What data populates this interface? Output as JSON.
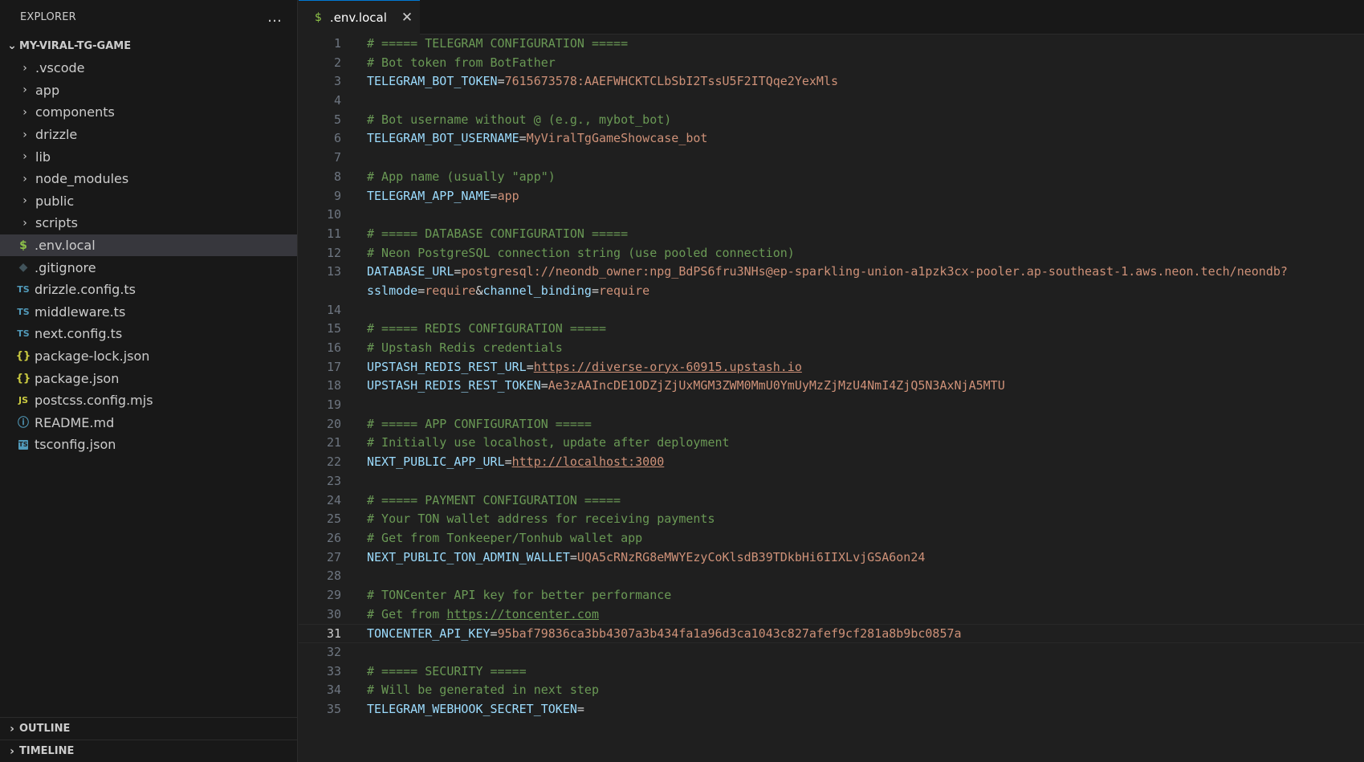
{
  "sidebar": {
    "title": "EXPLORER",
    "more_icon": "…",
    "project": "MY-VIRAL-TG-GAME",
    "folders": [
      ".vscode",
      "app",
      "components",
      "drizzle",
      "lib",
      "node_modules",
      "public",
      "scripts"
    ],
    "files": [
      {
        "name": ".env.local",
        "icon": "dollar-icon",
        "glyph": "$"
      },
      {
        "name": ".gitignore",
        "icon": "git-icon",
        "glyph": "◆"
      },
      {
        "name": "drizzle.config.ts",
        "icon": "ts-icon",
        "glyph": "TS"
      },
      {
        "name": "middleware.ts",
        "icon": "ts-icon",
        "glyph": "TS"
      },
      {
        "name": "next.config.ts",
        "icon": "ts-icon",
        "glyph": "TS"
      },
      {
        "name": "package-lock.json",
        "icon": "json-icon",
        "glyph": "{}"
      },
      {
        "name": "package.json",
        "icon": "json-icon",
        "glyph": "{}"
      },
      {
        "name": "postcss.config.mjs",
        "icon": "js-icon",
        "glyph": "JS"
      },
      {
        "name": "README.md",
        "icon": "info-icon",
        "glyph": "ⓘ"
      },
      {
        "name": "tsconfig.json",
        "icon": "tsconfig-icon",
        "glyph": "TS"
      }
    ],
    "sections": [
      "OUTLINE",
      "TIMELINE"
    ]
  },
  "editor": {
    "tab": {
      "label": ".env.local",
      "icon": "$",
      "close": "✕"
    },
    "active_line": 31,
    "lines": [
      {
        "n": "1",
        "parts": [
          [
            "c",
            "# ===== TELEGRAM CONFIGURATION ====="
          ]
        ]
      },
      {
        "n": "2",
        "parts": [
          [
            "c",
            "# Bot token from BotFather"
          ]
        ]
      },
      {
        "n": "3",
        "parts": [
          [
            "k",
            "TELEGRAM_BOT_TOKEN"
          ],
          [
            "e",
            "="
          ],
          [
            "v",
            "7615673578:AAEFWHCKTCLbSbI2TssU5F2ITQqe2YexMls"
          ]
        ]
      },
      {
        "n": "4",
        "parts": []
      },
      {
        "n": "5",
        "parts": [
          [
            "c",
            "# Bot username without @ (e.g., mybot_bot)"
          ]
        ]
      },
      {
        "n": "6",
        "parts": [
          [
            "k",
            "TELEGRAM_BOT_USERNAME"
          ],
          [
            "e",
            "="
          ],
          [
            "v",
            "MyViralTgGameShowcase_bot"
          ]
        ]
      },
      {
        "n": "7",
        "parts": []
      },
      {
        "n": "8",
        "parts": [
          [
            "c",
            "# App name (usually \"app\")"
          ]
        ]
      },
      {
        "n": "9",
        "parts": [
          [
            "k",
            "TELEGRAM_APP_NAME"
          ],
          [
            "e",
            "="
          ],
          [
            "v",
            "app"
          ]
        ]
      },
      {
        "n": "10",
        "parts": []
      },
      {
        "n": "11",
        "parts": [
          [
            "c",
            "# ===== DATABASE CONFIGURATION ====="
          ]
        ]
      },
      {
        "n": "12",
        "parts": [
          [
            "c",
            "# Neon PostgreSQL connection string (use pooled connection)"
          ]
        ]
      },
      {
        "n": "13",
        "parts": [
          [
            "k",
            "DATABASE_URL"
          ],
          [
            "e",
            "="
          ],
          [
            "v",
            "postgresql://neondb_owner:npg_BdPS6fru3NHs@ep-sparkling-union-a1pzk3cx-pooler.ap-southeast-1.aws.neon.tech/neondb?"
          ]
        ],
        "wrap": [
          [
            "k",
            "sslmode"
          ],
          [
            "e",
            "="
          ],
          [
            "v",
            "require"
          ],
          [
            "e",
            "&"
          ],
          [
            "k",
            "channel_binding"
          ],
          [
            "e",
            "="
          ],
          [
            "v",
            "require"
          ]
        ]
      },
      {
        "n": "14",
        "parts": []
      },
      {
        "n": "15",
        "parts": [
          [
            "c",
            "# ===== REDIS CONFIGURATION ====="
          ]
        ]
      },
      {
        "n": "16",
        "parts": [
          [
            "c",
            "# Upstash Redis credentials"
          ]
        ]
      },
      {
        "n": "17",
        "parts": [
          [
            "k",
            "UPSTASH_REDIS_REST_URL"
          ],
          [
            "e",
            "="
          ],
          [
            "u",
            "https://diverse-oryx-60915.upstash.io"
          ]
        ]
      },
      {
        "n": "18",
        "parts": [
          [
            "k",
            "UPSTASH_REDIS_REST_TOKEN"
          ],
          [
            "e",
            "="
          ],
          [
            "v",
            "Ae3zAAIncDE1ODZjZjUxMGM3ZWM0MmU0YmUyMzZjMzU4NmI4ZjQ5N3AxNjA5MTU"
          ]
        ]
      },
      {
        "n": "19",
        "parts": []
      },
      {
        "n": "20",
        "parts": [
          [
            "c",
            "# ===== APP CONFIGURATION ====="
          ]
        ]
      },
      {
        "n": "21",
        "parts": [
          [
            "c",
            "# Initially use localhost, update after deployment"
          ]
        ]
      },
      {
        "n": "22",
        "parts": [
          [
            "k",
            "NEXT_PUBLIC_APP_URL"
          ],
          [
            "e",
            "="
          ],
          [
            "u",
            "http://localhost:3000"
          ]
        ]
      },
      {
        "n": "23",
        "parts": []
      },
      {
        "n": "24",
        "parts": [
          [
            "c",
            "# ===== PAYMENT CONFIGURATION ====="
          ]
        ]
      },
      {
        "n": "25",
        "parts": [
          [
            "c",
            "# Your TON wallet address for receiving payments"
          ]
        ]
      },
      {
        "n": "26",
        "parts": [
          [
            "c",
            "# Get from Tonkeeper/Tonhub wallet app"
          ]
        ]
      },
      {
        "n": "27",
        "parts": [
          [
            "k",
            "NEXT_PUBLIC_TON_ADMIN_WALLET"
          ],
          [
            "e",
            "="
          ],
          [
            "v",
            "UQA5cRNzRG8eMWYEzyCoKlsdB39TDkbHi6IIXLvjGSA6on24"
          ]
        ]
      },
      {
        "n": "28",
        "parts": []
      },
      {
        "n": "29",
        "parts": [
          [
            "c",
            "# TONCenter API key for better performance"
          ]
        ]
      },
      {
        "n": "30",
        "parts": [
          [
            "c",
            "# Get from "
          ],
          [
            "cu",
            "https://toncenter.com"
          ]
        ]
      },
      {
        "n": "31",
        "parts": [
          [
            "k",
            "TONCENTER_API_KEY"
          ],
          [
            "e",
            "="
          ],
          [
            "v",
            "95baf79836ca3bb4307a3b434fa1a96d3ca1043c827afef9cf281a8b9bc0857a"
          ]
        ]
      },
      {
        "n": "32",
        "parts": []
      },
      {
        "n": "33",
        "parts": [
          [
            "c",
            "# ===== SECURITY ====="
          ]
        ]
      },
      {
        "n": "34",
        "parts": [
          [
            "c",
            "# Will be generated in next step"
          ]
        ]
      },
      {
        "n": "35",
        "parts": [
          [
            "k",
            "TELEGRAM_WEBHOOK_SECRET_TOKEN"
          ],
          [
            "e",
            "="
          ]
        ]
      }
    ]
  },
  "colors": {
    "comment": "#6a9955",
    "key": "#9cdcfe",
    "value": "#ce9178",
    "accent": "#0078d4",
    "selected_row": "#37373d"
  }
}
